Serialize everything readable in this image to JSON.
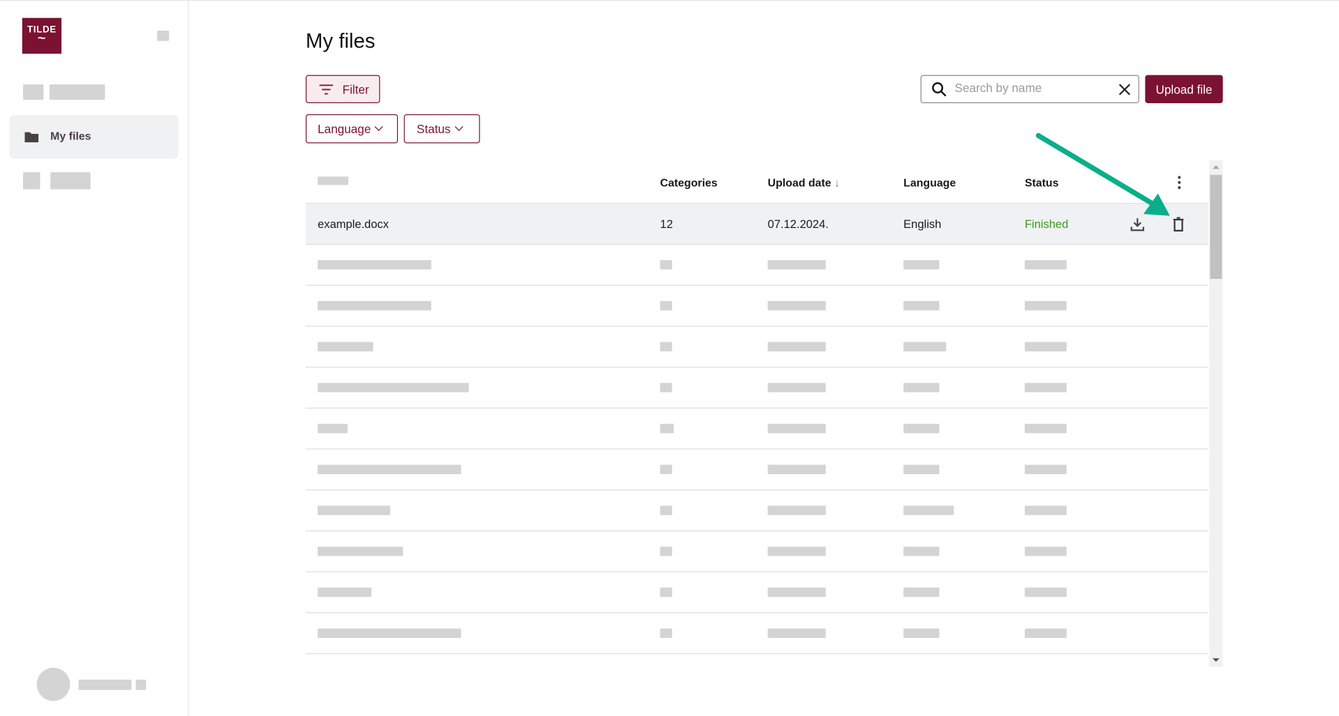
{
  "sidebar": {
    "logo_text": "TILDE",
    "active_item": {
      "label": "My files",
      "icon": "folder-icon"
    }
  },
  "page": {
    "title": "My files"
  },
  "toolbar": {
    "filter_label": "Filter",
    "language_label": "Language",
    "status_label": "Status",
    "search_placeholder": "Search by name",
    "search_value": "",
    "upload_label": "Upload file"
  },
  "table": {
    "columns": [
      "Categories",
      "Upload date",
      "Language",
      "Status"
    ],
    "sort": {
      "column": "Upload date",
      "direction": "descending"
    },
    "rows": [
      {
        "name": "example.docx",
        "categories": "12",
        "upload_date": "07.12.2024.",
        "language": "English",
        "status": "Finished"
      }
    ]
  },
  "colors": {
    "brand": "#7b1232",
    "status_finished": "#3a9a1e",
    "annotation_arrow": "#0aaf8a"
  }
}
